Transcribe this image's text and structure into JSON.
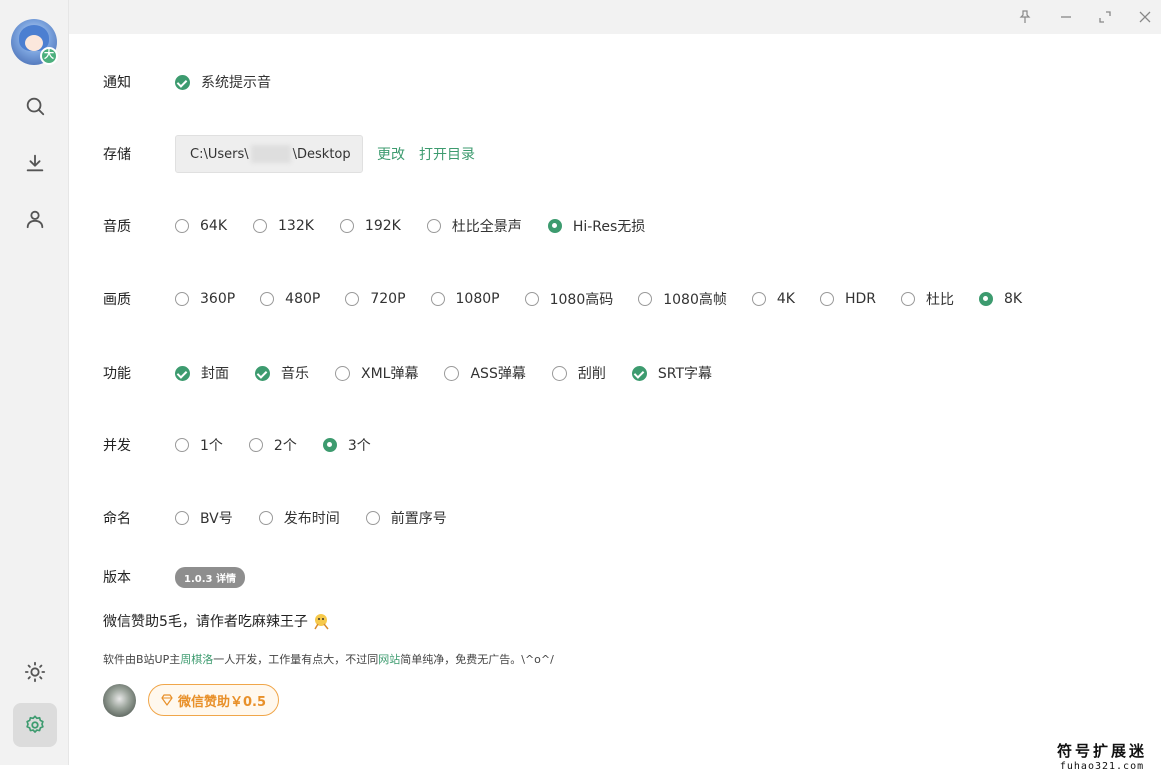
{
  "colors": {
    "accent": "#3d9b6f",
    "donate": "#e8902a",
    "sidebar_bg": "#f2f2f2"
  },
  "sidebar": {
    "avatar_badge": "大",
    "items": [
      {
        "icon": "search-icon"
      },
      {
        "icon": "download-icon"
      },
      {
        "icon": "user-icon"
      },
      {
        "icon": "theme-sun-icon"
      },
      {
        "icon": "settings-gear-icon",
        "active": true
      }
    ]
  },
  "titlebar": {
    "icons": [
      "pin-icon",
      "minimize-icon",
      "maximize-icon",
      "close-icon"
    ]
  },
  "settings": {
    "notify": {
      "label": "通知",
      "options": [
        {
          "label": "系统提示音",
          "checked": true
        }
      ]
    },
    "storage": {
      "label": "存储",
      "path_start": "C:\\Users\\",
      "path_end": "\\Desktop",
      "change": "更改",
      "open_dir": "打开目录"
    },
    "quality": {
      "label": "音质",
      "options": [
        {
          "label": "64K",
          "selected": false
        },
        {
          "label": "132K",
          "selected": false
        },
        {
          "label": "192K",
          "selected": false
        },
        {
          "label": "杜比全景声",
          "selected": false
        },
        {
          "label": "Hi-Res无损",
          "selected": true
        }
      ]
    },
    "video": {
      "label": "画质",
      "options": [
        {
          "label": "360P",
          "selected": false
        },
        {
          "label": "480P",
          "selected": false
        },
        {
          "label": "720P",
          "selected": false
        },
        {
          "label": "1080P",
          "selected": false
        },
        {
          "label": "1080高码",
          "selected": false
        },
        {
          "label": "1080高帧",
          "selected": false
        },
        {
          "label": "4K",
          "selected": false
        },
        {
          "label": "HDR",
          "selected": false
        },
        {
          "label": "杜比",
          "selected": false
        },
        {
          "label": "8K",
          "selected": true
        }
      ]
    },
    "features": {
      "label": "功能",
      "options": [
        {
          "label": "封面",
          "checked": true
        },
        {
          "label": "音乐",
          "checked": true
        },
        {
          "label": "XML弹幕",
          "checked": false
        },
        {
          "label": "ASS弹幕",
          "checked": false
        },
        {
          "label": "刮削",
          "checked": false
        },
        {
          "label": "SRT字幕",
          "checked": true
        }
      ]
    },
    "concurrency": {
      "label": "并发",
      "options": [
        {
          "label": "1个",
          "selected": false
        },
        {
          "label": "2个",
          "selected": false
        },
        {
          "label": "3个",
          "selected": true
        }
      ]
    },
    "naming": {
      "label": "命名",
      "options": [
        {
          "label": "BV号",
          "selected": false
        },
        {
          "label": "发布时间",
          "selected": false
        },
        {
          "label": "前置序号",
          "selected": false
        }
      ]
    },
    "version": {
      "label": "版本",
      "badge": "1.0.3 详情"
    }
  },
  "donate": {
    "title": "微信赞助5毛，请作者吃麻辣王子",
    "note_prefix": "软件由B站UP主",
    "note_author": "周棋洛",
    "note_mid": "一人开发，工作量有点大，不过同",
    "note_site": "网站",
    "note_suffix": "简单纯净，免费无广告。\\^o^/",
    "button": "微信赞助￥0.5"
  },
  "watermark": {
    "line1": "符号扩展迷",
    "line2": "fuhao321.com"
  }
}
